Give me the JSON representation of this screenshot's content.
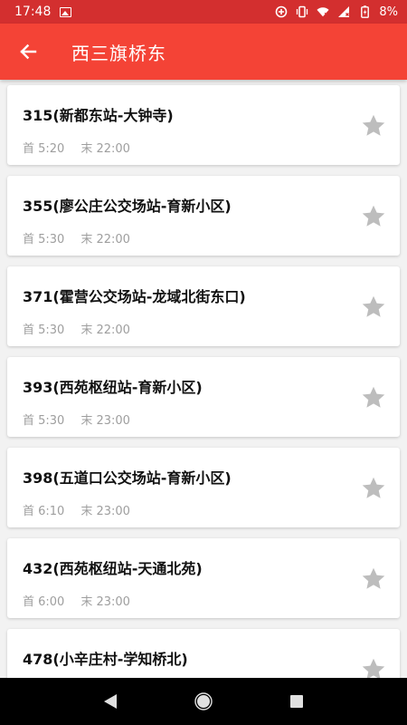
{
  "status": {
    "time": "17:48",
    "battery": "8%"
  },
  "header": {
    "title": "西三旗桥东"
  },
  "routes": [
    {
      "name": "315(新都东站-大钟寺)",
      "first": "首 5:20",
      "last": "末 22:00"
    },
    {
      "name": "355(廖公庄公交场站-育新小区)",
      "first": "首 5:30",
      "last": "末 22:00"
    },
    {
      "name": "371(霍营公交场站-龙域北街东口)",
      "first": "首 5:30",
      "last": "末 22:00"
    },
    {
      "name": "393(西苑枢纽站-育新小区)",
      "first": "首 5:30",
      "last": "末 23:00"
    },
    {
      "name": "398(五道口公交场站-育新小区)",
      "first": "首 6:10",
      "last": "末 23:00"
    },
    {
      "name": "432(西苑枢纽站-天通北苑)",
      "first": "首 6:00",
      "last": "末 23:00"
    },
    {
      "name": "478(小辛庄村-学知桥北)",
      "first": "",
      "last": ""
    }
  ],
  "colors": {
    "status_bar": "#d32f2f",
    "app_bar": "#f44336",
    "star": "#bdbdbd"
  }
}
